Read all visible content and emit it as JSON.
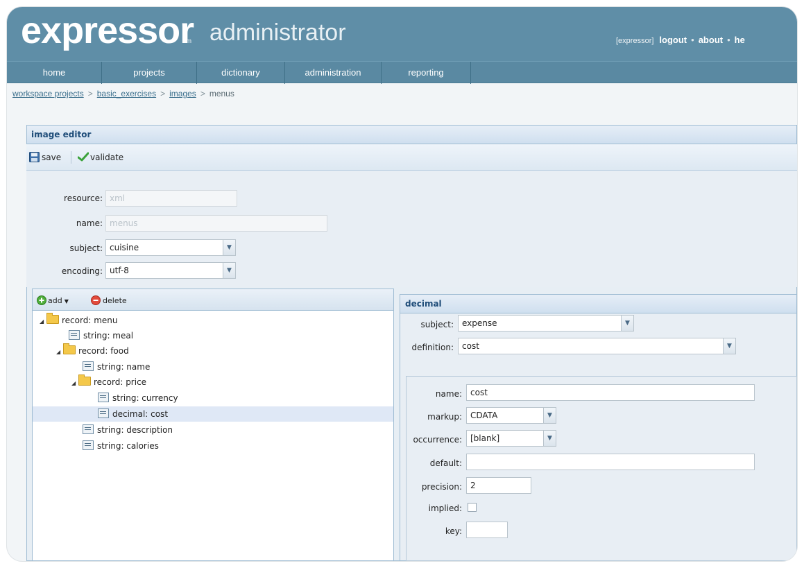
{
  "header": {
    "logo_text": "expressor",
    "logo_tm": "tm",
    "app_title": "administrator",
    "user": "[expressor]",
    "links": [
      "logout",
      "about",
      "he"
    ]
  },
  "nav": [
    "home",
    "projects",
    "dictionary",
    "administration",
    "reporting"
  ],
  "breadcrumb": {
    "items": [
      "workspace projects",
      "basic_exercises",
      "images"
    ],
    "current": "menus"
  },
  "editor": {
    "title": "image editor",
    "save": "save",
    "validate": "validate",
    "resource_label": "resource:",
    "resource_value": "xml",
    "name_label": "name:",
    "name_value": "menus",
    "subject_label": "subject:",
    "subject_value": "cuisine",
    "encoding_label": "encoding:",
    "encoding_value": "utf-8"
  },
  "tree": {
    "add": "add",
    "delete": "delete",
    "rows": [
      "record: menu",
      "string: meal",
      "record: food",
      "string: name",
      "record: price",
      "string: currency",
      "decimal: cost",
      "string: description",
      "string: calories"
    ]
  },
  "detail": {
    "title": "decimal",
    "subject_label": "subject:",
    "subject_value": "expense",
    "definition_label": "definition:",
    "definition_value": "cost",
    "name_label": "name:",
    "name_value": "cost",
    "markup_label": "markup:",
    "markup_value": "CDATA",
    "occurrence_label": "occurrence:",
    "occurrence_value": "[blank]",
    "default_label": "default:",
    "default_value": "",
    "precision_label": "precision:",
    "precision_value": "2",
    "implied_label": "implied:",
    "key_label": "key:",
    "key_value": ""
  },
  "colors": {
    "header": "#5f8ea7",
    "nav": "#5a89a2",
    "panel_title": "#1f4d79",
    "selection": "#dfe8f6"
  }
}
